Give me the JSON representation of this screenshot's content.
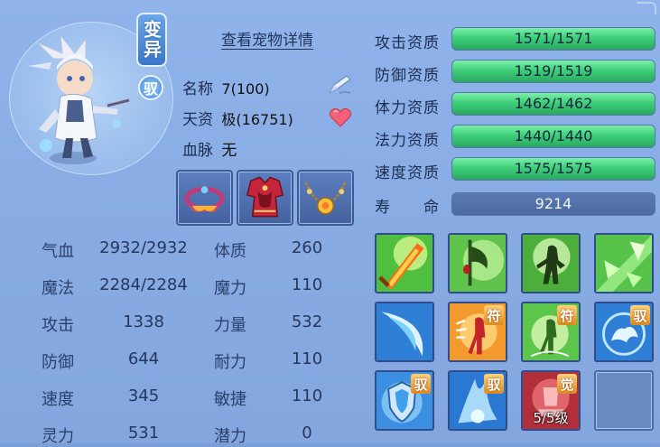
{
  "pet": {
    "variant_badge": "变异",
    "yu_badge": "驭",
    "view_details_label": "查看宠物详情",
    "name_label": "名称",
    "name_value": "7(100)",
    "talent_label": "天资",
    "talent_value": "极(16751)",
    "bloodline_label": "血脉",
    "bloodline_value": "无"
  },
  "equipment": [
    {
      "name": "necklace-flame"
    },
    {
      "name": "armor-red"
    },
    {
      "name": "bead-necklace"
    }
  ],
  "stats_left": [
    {
      "label": "气血",
      "value": "2932/2932"
    },
    {
      "label": "魔法",
      "value": "2284/2284"
    },
    {
      "label": "攻击",
      "value": "1338"
    },
    {
      "label": "防御",
      "value": "644"
    },
    {
      "label": "速度",
      "value": "345"
    },
    {
      "label": "灵力",
      "value": "531"
    }
  ],
  "stats_right": [
    {
      "label": "体质",
      "value": "260"
    },
    {
      "label": "魔力",
      "value": "110"
    },
    {
      "label": "力量",
      "value": "532"
    },
    {
      "label": "耐力",
      "value": "110"
    },
    {
      "label": "敏捷",
      "value": "110"
    },
    {
      "label": "潜力",
      "value": "0"
    }
  ],
  "aptitudes": [
    {
      "label": "攻击资质",
      "text": "1571/1571",
      "fill": 1.0
    },
    {
      "label": "防御资质",
      "text": "1519/1519",
      "fill": 1.0
    },
    {
      "label": "体力资质",
      "text": "1462/1462",
      "fill": 1.0
    },
    {
      "label": "法力资质",
      "text": "1440/1440",
      "fill": 1.0
    },
    {
      "label": "速度资质",
      "text": "1575/1575",
      "fill": 1.0
    }
  ],
  "lifespan": {
    "label": "寿　　命",
    "text": "9214"
  },
  "skill_tags": {
    "fu": "符",
    "yu": "驭",
    "jue": "觉"
  },
  "awaken_level": "5/5级",
  "colors": {
    "accent_green": "#3ecf7a",
    "panel_blue": "#8fb3ea",
    "badge_orange": "#e08a1c"
  }
}
